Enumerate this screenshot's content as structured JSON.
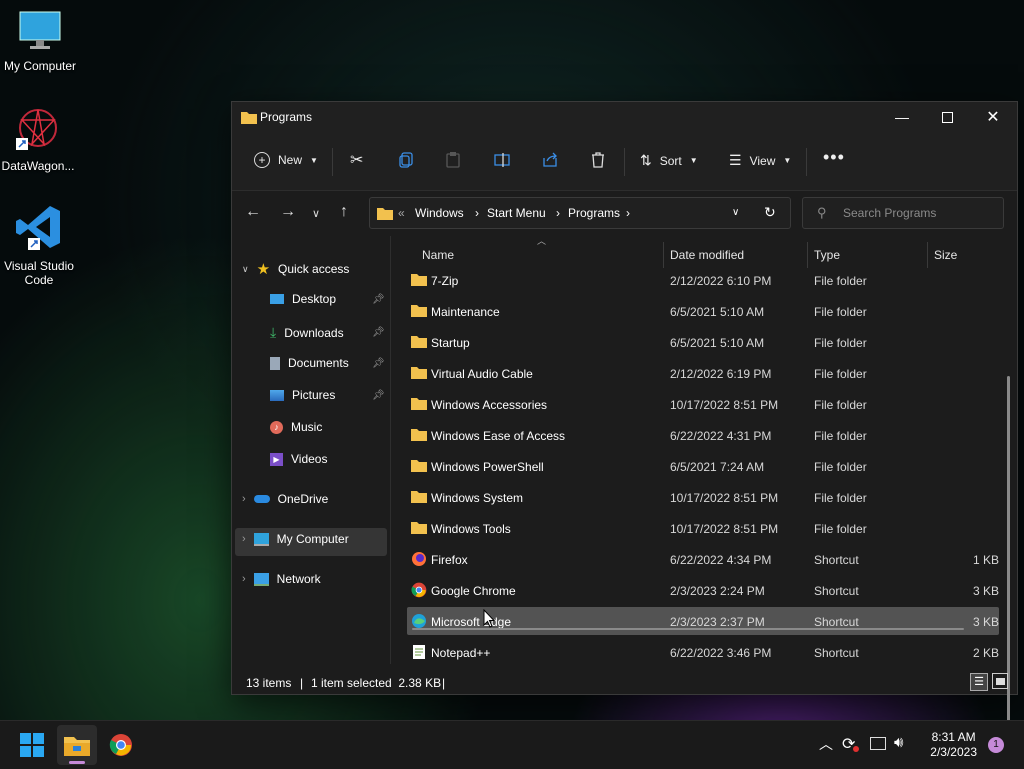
{
  "desktop": {
    "icons": [
      {
        "label": "My Computer"
      },
      {
        "label": "DataWagon..."
      },
      {
        "label": "Visual Studio Code"
      }
    ]
  },
  "window": {
    "title": "Programs"
  },
  "toolbar": {
    "new_label": "New",
    "sort_label": "Sort",
    "view_label": "View"
  },
  "address": {
    "crumbs": [
      "Windows",
      "Start Menu",
      "Programs"
    ]
  },
  "search": {
    "placeholder": "Search Programs"
  },
  "nav": {
    "quick_access": "Quick access",
    "items": [
      "Desktop",
      "Downloads",
      "Documents",
      "Pictures",
      "Music",
      "Videos"
    ],
    "onedrive": "OneDrive",
    "my_computer": "My Computer",
    "network": "Network"
  },
  "columns": {
    "name": "Name",
    "date": "Date modified",
    "type": "Type",
    "size": "Size"
  },
  "files": [
    {
      "name": "7-Zip",
      "date": "2/12/2022 6:10 PM",
      "type": "File folder",
      "size": "",
      "kind": "folder"
    },
    {
      "name": "Maintenance",
      "date": "6/5/2021 5:10 AM",
      "type": "File folder",
      "size": "",
      "kind": "folder"
    },
    {
      "name": "Startup",
      "date": "6/5/2021 5:10 AM",
      "type": "File folder",
      "size": "",
      "kind": "folder"
    },
    {
      "name": "Virtual Audio Cable",
      "date": "2/12/2022 6:19 PM",
      "type": "File folder",
      "size": "",
      "kind": "folder"
    },
    {
      "name": "Windows Accessories",
      "date": "10/17/2022 8:51 PM",
      "type": "File folder",
      "size": "",
      "kind": "folder"
    },
    {
      "name": "Windows Ease of Access",
      "date": "6/22/2022 4:31 PM",
      "type": "File folder",
      "size": "",
      "kind": "folder"
    },
    {
      "name": "Windows PowerShell",
      "date": "6/5/2021 7:24 AM",
      "type": "File folder",
      "size": "",
      "kind": "folder"
    },
    {
      "name": "Windows System",
      "date": "10/17/2022 8:51 PM",
      "type": "File folder",
      "size": "",
      "kind": "folder"
    },
    {
      "name": "Windows Tools",
      "date": "10/17/2022 8:51 PM",
      "type": "File folder",
      "size": "",
      "kind": "folder"
    },
    {
      "name": "Firefox",
      "date": "6/22/2022 4:34 PM",
      "type": "Shortcut",
      "size": "1 KB",
      "kind": "firefox"
    },
    {
      "name": "Google Chrome",
      "date": "2/3/2023 2:24 PM",
      "type": "Shortcut",
      "size": "3 KB",
      "kind": "chrome"
    },
    {
      "name": "Microsoft Edge",
      "date": "2/3/2023 2:37 PM",
      "type": "Shortcut",
      "size": "3 KB",
      "kind": "edge"
    },
    {
      "name": "Notepad++",
      "date": "6/22/2022 3:46 PM",
      "type": "Shortcut",
      "size": "2 KB",
      "kind": "notepad"
    }
  ],
  "status": {
    "count": "13 items",
    "selected": "1 item selected  2.38 KB"
  },
  "taskbar": {
    "time": "8:31 AM",
    "date": "2/3/2023",
    "notifications": "1"
  }
}
